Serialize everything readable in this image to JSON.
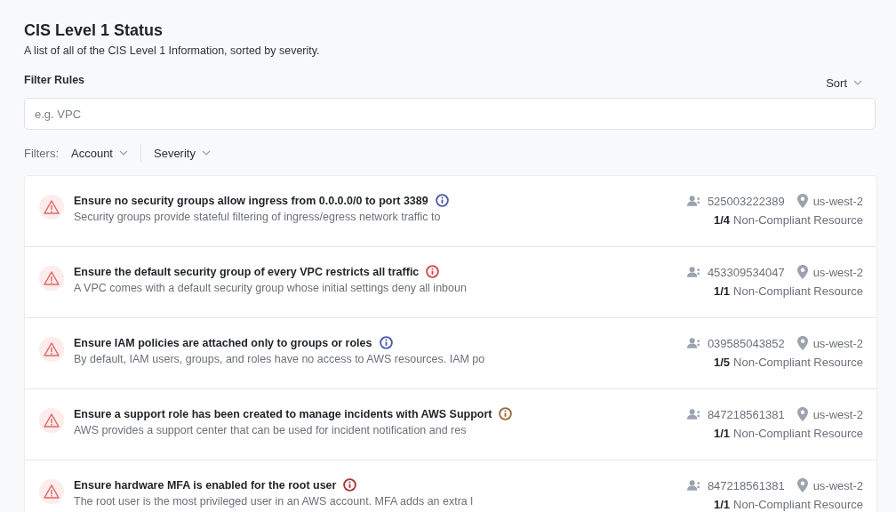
{
  "header": {
    "title": "CIS Level 1 Status",
    "subtitle": "A list of all of the CIS Level 1 Information, sorted by severity."
  },
  "filter": {
    "label": "Filter Rules",
    "placeholder": "e.g. VPC",
    "sort": "Sort"
  },
  "filters": {
    "label": "Filters:",
    "dropdowns": [
      "Account",
      "Severity"
    ]
  },
  "rules": [
    {
      "title": "Ensure no security groups allow ingress from 0.0.0.0/0 to port 3389",
      "color": "#4a5ab0",
      "description": "Security groups provide stateful filtering of ingress/egress network traffic to",
      "account": "525003222389",
      "region": "us-west-2",
      "count": "1/4",
      "count_label": "Non-Compliant Resource"
    },
    {
      "title": "Ensure the default security group of every VPC restricts all traffic",
      "color": "#d64545",
      "description": "A VPC comes with a default security group whose initial settings deny all inboun",
      "account": "453309534047",
      "region": "us-west-2",
      "count": "1/1",
      "count_label": "Non-Compliant Resource"
    },
    {
      "title": "Ensure IAM policies are attached only to groups or roles",
      "color": "#4a5ab0",
      "description": "By default, IAM users, groups, and roles have no access to AWS resources. IAM po",
      "account": "039585043852",
      "region": "us-west-2",
      "count": "1/5",
      "count_label": "Non-Compliant Resource"
    },
    {
      "title": "Ensure a support role has been created to manage incidents with AWS Support",
      "color": "#9a6a32",
      "description": "AWS provides a support center that can be used for incident notification and res",
      "account": "847218561381",
      "region": "us-west-2",
      "count": "1/1",
      "count_label": "Non-Compliant Resource"
    },
    {
      "title": "Ensure hardware MFA is enabled for the root user",
      "color": "#a83232",
      "description": "The root user is the most privileged user in an AWS account. MFA adds an extra l",
      "account": "847218561381",
      "region": "us-west-2",
      "count": "1/1",
      "count_label": "Non-Compliant Resource"
    }
  ]
}
